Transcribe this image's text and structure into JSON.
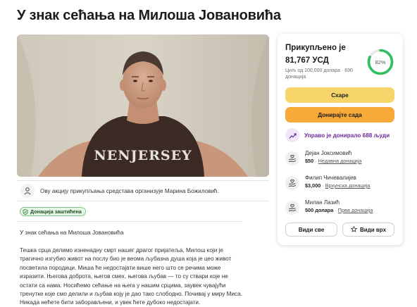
{
  "page": {
    "title": "У знак сећања на Милоша Јовановића"
  },
  "organizer": {
    "text": "Ову акцију прикупљања средстава организује Марина Божиловић."
  },
  "badge": {
    "label": "Донација заштићена"
  },
  "story": {
    "heading": "У знак сећања на Милоша Јовановића",
    "body": "Тешка срца делимо изненадну смрт нашег драгог пријатеља, Милош који је трагично изгубио живот на послу био је веома љубазна душа која је цео живот посветила породици. Миша ће недостајати више него што се речима може изразити. Његова доброта, његов смех, његова љубав — то су ствари које не остати са нама. Носићемо сећање на њега у нашим срцима, заувек чувајући тренутке које смо делили и љубав коју је дао тако слободно. Почивај у миру Миса. Никада нећете бити заборављени, и увек ћете дубоко недостајати."
  },
  "donation_card": {
    "raised_label": "Прикупљено је",
    "raised_amount": "81,767 УСД",
    "goal_text": "Циљ од 100,000 долара",
    "donations_count": "690",
    "donations_label": "донација",
    "percent_label": "82%",
    "percent_value": 0.82,
    "share_button": "Схаре",
    "donate_button": "Донирајте сада",
    "recent_text": "Управо је донирало 688 људи",
    "accent_color": "#2fbf5f",
    "share_color": "#f8d56a",
    "donate_color": "#f7a93a",
    "recent_color": "#6a2a9b"
  },
  "donors": [
    {
      "name": "Дејан Јоксимовић",
      "amount": "$50",
      "tag": "Недавна донација"
    },
    {
      "name": "Филип Чичевалијев",
      "amount": "$3,000",
      "tag": "Врхунска донација"
    },
    {
      "name": "Милан Лазић",
      "amount": "500 долара",
      "tag": "Прва донација"
    }
  ],
  "buttons": {
    "see_all": "Види све",
    "see_top": "Види врх"
  },
  "photo": {
    "shirt_text": "NENJERSEY"
  },
  "icons": {
    "organizer": "person-icon",
    "badge": "shield-icon",
    "recent": "trending-up-icon",
    "donor": "donation-hand-icon",
    "see_top": "star-icon"
  }
}
